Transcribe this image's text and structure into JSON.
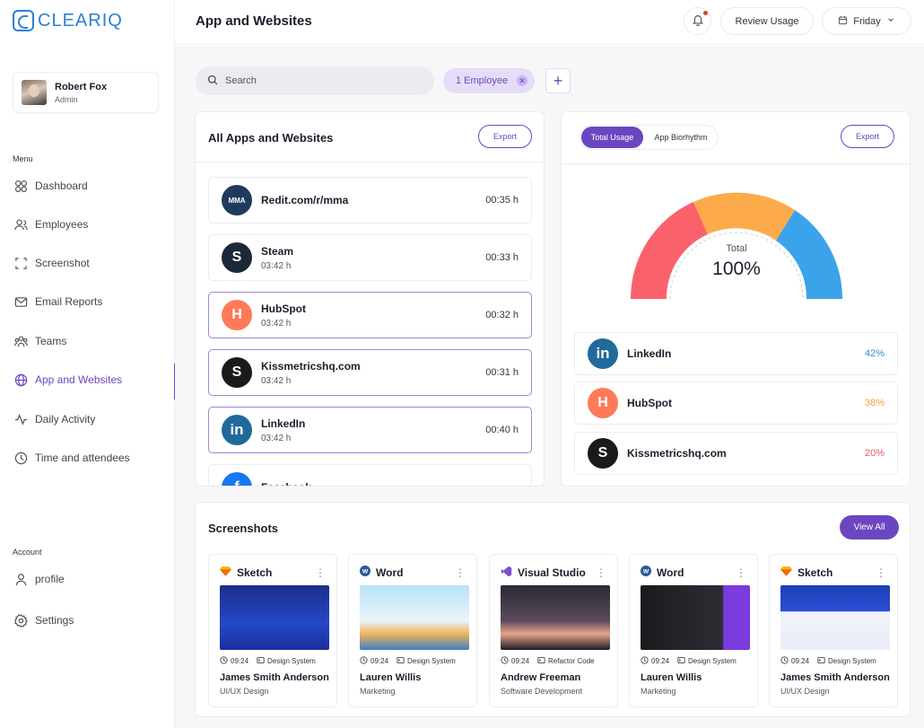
{
  "brand": {
    "name": "CLEARIQ",
    "color": "#2b7fd6"
  },
  "user": {
    "name": "Robert Fox",
    "role": "Admin"
  },
  "sidebar": {
    "menu_label": "Menu",
    "items": [
      {
        "label": "Dashboard",
        "icon": "dashboard-icon"
      },
      {
        "label": "Employees",
        "icon": "users-icon"
      },
      {
        "label": "Screenshot",
        "icon": "screenshot-icon"
      },
      {
        "label": "Email Reports",
        "icon": "mail-icon"
      },
      {
        "label": "Teams",
        "icon": "teams-icon"
      },
      {
        "label": "App and Websites",
        "icon": "globe-icon",
        "active": true
      },
      {
        "label": "Daily Activity",
        "icon": "activity-icon"
      },
      {
        "label": "Time and attendees",
        "icon": "clock-icon"
      }
    ],
    "account_label": "Account",
    "account_items": [
      {
        "label": "profile",
        "icon": "user-icon"
      },
      {
        "label": "Settings",
        "icon": "gear-icon"
      }
    ]
  },
  "header": {
    "title": "App and Websites",
    "review_label": "Review Usage",
    "day_label": "Friday"
  },
  "filters": {
    "search_placeholder": "Search",
    "chip_label": "1 Employee"
  },
  "apps": {
    "title": "All Apps and Websites",
    "export_label": "Export",
    "rows": [
      {
        "name": "Redit.com/r/mma",
        "sub": "",
        "time": "00:35 h",
        "logo": "MMA",
        "color": "#1f3b5c"
      },
      {
        "name": "Steam",
        "sub": "03:42 h",
        "time": "00:33 h",
        "logo": "S",
        "color": "#1b2838"
      },
      {
        "name": "HubSpot",
        "sub": "03:42 h",
        "time": "00:32 h",
        "logo": "H",
        "color": "#ff7a59"
      },
      {
        "name": "Kissmetricshq.com",
        "sub": "03:42 h",
        "time": "00:31 h",
        "logo": "S",
        "color": "#1a1a1a"
      },
      {
        "name": "LinkedIn",
        "sub": "03:42 h",
        "time": "00:40 h",
        "logo": "in",
        "color": "#1f6a9a"
      },
      {
        "name": "Facebook",
        "sub": "",
        "time": "",
        "logo": "f",
        "color": "#1877f2"
      }
    ]
  },
  "usage": {
    "tab_active": "Total Usage",
    "tab_inactive": "App Biorhythm",
    "export_label": "Export",
    "gauge_label": "Total",
    "gauge_value": "100%",
    "colors": {
      "red": "#f9626b",
      "orange": "#fdab4a",
      "blue": "#3aa3ea"
    },
    "shares": [
      {
        "name": "LinkedIn",
        "pct": "42%",
        "logo": "in",
        "color": "#1f6a9a",
        "pct_color": "#2b8fd6"
      },
      {
        "name": "HubSpot",
        "pct": "38%",
        "logo": "H",
        "color": "#ff7a59",
        "pct_color": "#f5a13a"
      },
      {
        "name": "Kissmetricshq.com",
        "pct": "20%",
        "logo": "S",
        "color": "#1a1a1a",
        "pct_color": "#f2555f"
      }
    ]
  },
  "screenshots": {
    "title": "Screenshots",
    "view_all_label": "View All",
    "items": [
      {
        "app": "Sketch",
        "time": "09:24",
        "tag": "Design System",
        "person": "James Smith Anderson",
        "role": "UI/UX Design",
        "thumb": "blue"
      },
      {
        "app": "Word",
        "time": "09:24",
        "tag": "Design System",
        "person": "Lauren Willis",
        "role": "Marketing",
        "thumb": "sky"
      },
      {
        "app": "Visual Studio",
        "time": "09:24",
        "tag": "Refactor Code",
        "person": "Andrew Freeman",
        "role": "Software Development",
        "thumb": "dark"
      },
      {
        "app": "Word",
        "time": "09:24",
        "tag": "Design System",
        "person": "Lauren Willis",
        "role": "Marketing",
        "thumb": "black"
      },
      {
        "app": "Sketch",
        "time": "09:24",
        "tag": "Design System",
        "person": "James Smith Anderson",
        "role": "UI/UX Design",
        "thumb": "royal"
      }
    ]
  }
}
